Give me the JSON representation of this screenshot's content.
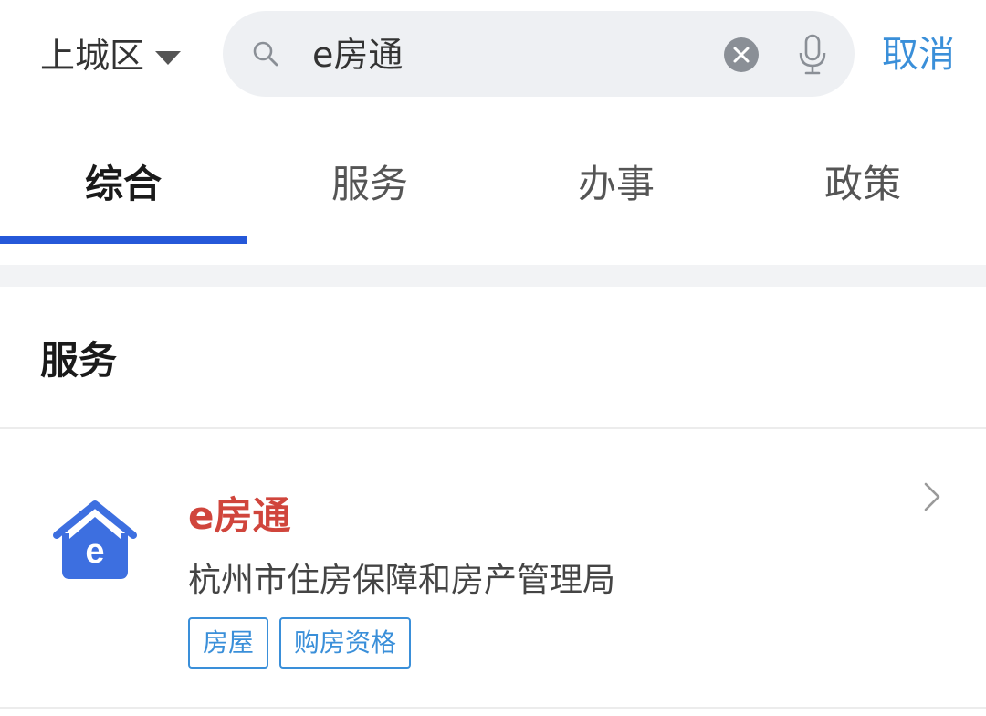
{
  "header": {
    "district": "上城区",
    "search_value": "e房通",
    "cancel_label": "取消"
  },
  "tabs": [
    {
      "label": "综合",
      "active": true
    },
    {
      "label": "服务",
      "active": false
    },
    {
      "label": "办事",
      "active": false
    },
    {
      "label": "政策",
      "active": false
    }
  ],
  "section": {
    "title": "服务"
  },
  "result": {
    "title": "e房通",
    "subtitle": "杭州市住房保障和房产管理局",
    "logo_letter": "e",
    "tags": [
      "房屋",
      "购房资格"
    ]
  },
  "icons": {
    "search": "search-icon",
    "clear": "clear-icon",
    "mic": "microphone-icon",
    "dropdown": "caret-down-icon",
    "chevron": "chevron-right-icon"
  },
  "colors": {
    "accent_blue": "#3a8fd9",
    "tab_indicator": "#2558d9",
    "title_red": "#d0453c",
    "logo_blue": "#3d6fe0"
  }
}
